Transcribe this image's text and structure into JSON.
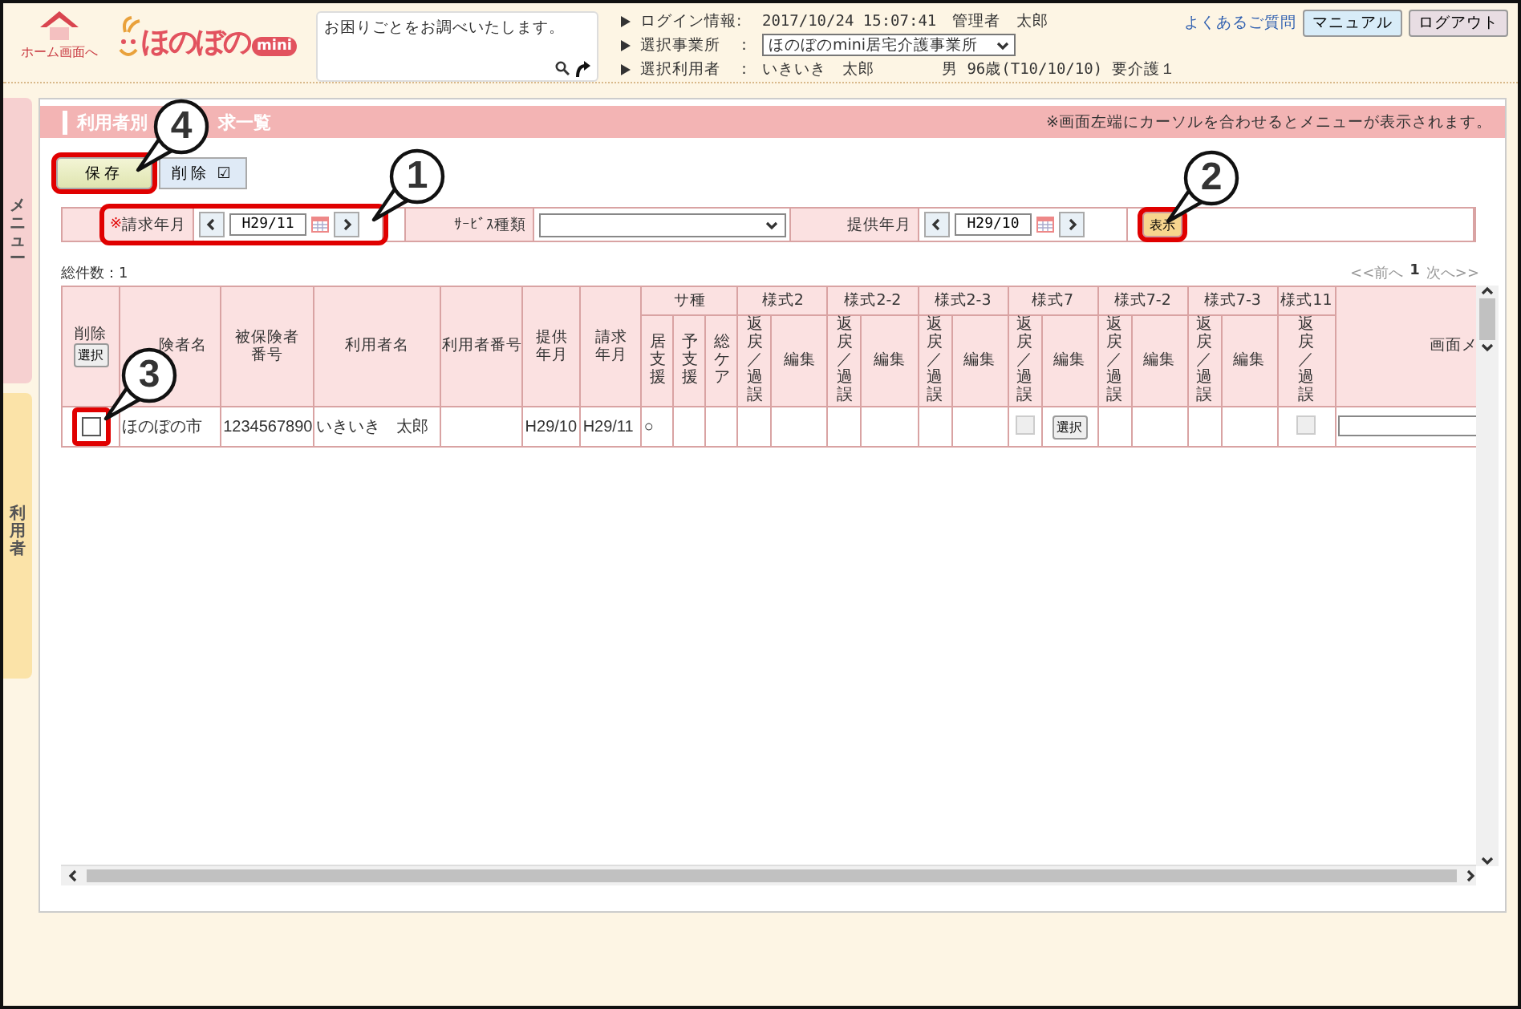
{
  "header": {
    "home_label": "ホーム画面へ",
    "logo": "ほのぼの",
    "logo_badge": "mini",
    "help_text": "お困りごとをお調べいたします。",
    "info": [
      {
        "kind": "text",
        "label": "ログイン情報:",
        "value": "2017/10/24 15:07:41　管理者　太郎"
      },
      {
        "kind": "select",
        "label": "選択事業所　：",
        "value": "ほのぼのmini居宅介護事業所"
      },
      {
        "kind": "user",
        "label": "選択利用者　：",
        "value": "いきいき　太郎",
        "extra": "男 96歳(T10/10/10) 要介護１"
      }
    ],
    "link": "よくあるご質問",
    "buttons": [
      {
        "kind": "manual",
        "label": "マニュアル"
      },
      {
        "kind": "logout",
        "label": "ログアウト"
      }
    ]
  },
  "side_tabs": [
    {
      "kind": "menu",
      "label": "メニュー"
    },
    {
      "kind": "user",
      "label": "利用者"
    }
  ],
  "title_parts": [
    "利用者別",
    "求一覧"
  ],
  "notice": "※画面左端にカーソルを合わせるとメニューが表示されます。",
  "toolbar": [
    {
      "kind": "save",
      "label": "保存",
      "highlighted": true
    },
    {
      "kind": "delete",
      "label": "削除",
      "mark": "☑",
      "highlighted": false
    }
  ],
  "filters": {
    "billing": {
      "required_mark": "※",
      "label": "請求年月",
      "value": "H29/11",
      "highlighted": true
    },
    "service": {
      "label": "ｻｰﾋﾞｽ種類"
    },
    "provided": {
      "label": "提供年月",
      "value": "H29/10",
      "highlighted": false
    },
    "show_button": {
      "label": "表示",
      "highlighted": true
    }
  },
  "total": "総件数：1",
  "pager": {
    "prev": "<<前へ",
    "page": "1",
    "next": "次へ>>"
  },
  "columns": [
    {
      "kind": "single",
      "lines": [
        "削除"
      ],
      "button": "選択"
    },
    {
      "kind": "single",
      "lines": [
        "険者名"
      ]
    },
    {
      "kind": "single",
      "lines": [
        "被保険者",
        "番号"
      ]
    },
    {
      "kind": "single",
      "lines": [
        "利用者名"
      ]
    },
    {
      "kind": "single",
      "lines": [
        "利用者番号"
      ]
    },
    {
      "kind": "single",
      "lines": [
        "提供",
        "年月"
      ]
    },
    {
      "kind": "single",
      "lines": [
        "請求",
        "年月"
      ]
    },
    {
      "kind": "group",
      "label": "サ種",
      "children": [
        {
          "kind": "vertical",
          "text": "居支援"
        },
        {
          "kind": "vertical",
          "text": "予支援"
        },
        {
          "kind": "vertical",
          "text": "総ケア"
        }
      ]
    },
    {
      "kind": "group",
      "label": "様式2",
      "children": [
        {
          "kind": "vertical",
          "text": "返戻／過誤"
        },
        {
          "kind": "plain",
          "text": "編集"
        }
      ]
    },
    {
      "kind": "group",
      "label": "様式2-2",
      "children": [
        {
          "kind": "vertical",
          "text": "返戻／過誤"
        },
        {
          "kind": "plain",
          "text": "編集"
        }
      ]
    },
    {
      "kind": "group",
      "label": "様式2-3",
      "children": [
        {
          "kind": "vertical",
          "text": "返戻／過誤"
        },
        {
          "kind": "plain",
          "text": "編集"
        }
      ]
    },
    {
      "kind": "group",
      "label": "様式7",
      "children": [
        {
          "kind": "vertical",
          "text": "返戻／過誤"
        },
        {
          "kind": "plain",
          "text": "編集"
        }
      ]
    },
    {
      "kind": "group",
      "label": "様式7-2",
      "children": [
        {
          "kind": "vertical",
          "text": "返戻／過誤"
        },
        {
          "kind": "plain",
          "text": "編集"
        }
      ]
    },
    {
      "kind": "group",
      "label": "様式7-3",
      "children": [
        {
          "kind": "vertical",
          "text": "返戻／過誤"
        },
        {
          "kind": "plain",
          "text": "編集"
        }
      ]
    },
    {
      "kind": "group",
      "label": "様式11",
      "children": [
        {
          "kind": "vertical",
          "text": "返戻／過誤"
        }
      ]
    },
    {
      "kind": "single",
      "lines": [
        "画面メ"
      ]
    }
  ],
  "rows": [
    {
      "cells": [
        {
          "kind": "checkbox",
          "checked": false,
          "disabled": false,
          "highlighted": true
        },
        {
          "kind": "text",
          "text": "ほのぼの市"
        },
        {
          "kind": "text",
          "text": "1234567890"
        },
        {
          "kind": "text",
          "text": "いきいき　太郎"
        },
        {
          "kind": "empty"
        },
        {
          "kind": "text",
          "text": "H29/10"
        },
        {
          "kind": "text",
          "text": "H29/11"
        },
        {
          "kind": "text",
          "text": "○"
        },
        {
          "kind": "empty"
        },
        {
          "kind": "empty"
        },
        {
          "kind": "empty"
        },
        {
          "kind": "empty"
        },
        {
          "kind": "empty"
        },
        {
          "kind": "empty"
        },
        {
          "kind": "empty"
        },
        {
          "kind": "empty"
        },
        {
          "kind": "checkbox",
          "checked": false,
          "disabled": true,
          "highlighted": false
        },
        {
          "kind": "button",
          "label": "選択"
        },
        {
          "kind": "empty"
        },
        {
          "kind": "empty"
        },
        {
          "kind": "empty"
        },
        {
          "kind": "empty"
        },
        {
          "kind": "checkbox",
          "checked": false,
          "disabled": true,
          "highlighted": false
        },
        {
          "kind": "input"
        }
      ]
    }
  ],
  "annotations": [
    {
      "number": "4"
    },
    {
      "number": "1"
    },
    {
      "number": "2"
    },
    {
      "number": "3"
    }
  ]
}
